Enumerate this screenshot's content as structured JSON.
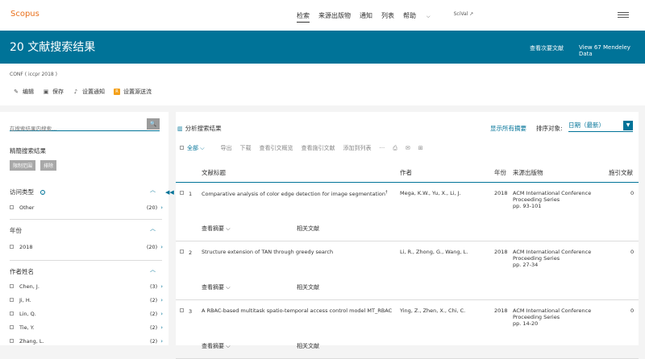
{
  "header": {
    "logo": "Scopus",
    "nav": [
      "检索",
      "来源出版物",
      "通知",
      "列表",
      "帮助"
    ],
    "chevron": "⌵",
    "scival": "SciVal ↗"
  },
  "banner": {
    "title": "20 文献搜索结果",
    "view_secondary": "查看次要文献",
    "view_mendeley": "View 67 Mendeley Data"
  },
  "query": "CONF ( iccpr  2018 )",
  "actions": [
    {
      "label": "编辑",
      "icon": "pencil-icon",
      "glyph": "✎"
    },
    {
      "label": "保存",
      "icon": "save-icon",
      "glyph": "▣"
    },
    {
      "label": "设置通知",
      "icon": "bell-icon",
      "glyph": "♪"
    },
    {
      "label": "设置源送流",
      "icon": "rss-icon",
      "glyph": "R"
    }
  ],
  "sidebar": {
    "search_placeholder": "在搜索结果内搜索...",
    "search_icon": "🔍",
    "refine_title": "精簡搜索结果",
    "limit_label": "限制范围",
    "exclude_label": "排除",
    "facets": [
      {
        "title": "访问类型",
        "info": "i",
        "items": [
          {
            "label": "Other",
            "count": "(20)"
          }
        ]
      },
      {
        "title": "年份",
        "items": [
          {
            "label": "2018",
            "count": "(20)"
          }
        ]
      },
      {
        "title": "作者姓名",
        "items": [
          {
            "label": "Chen, J.",
            "count": "(3)"
          },
          {
            "label": "Ji, H.",
            "count": "(2)"
          },
          {
            "label": "Lin, Q.",
            "count": "(2)"
          },
          {
            "label": "Tie, Y.",
            "count": "(2)"
          },
          {
            "label": "Zhang, L.",
            "count": "(2)"
          }
        ]
      }
    ],
    "toggle": "︿",
    "arrow": "›",
    "collapse": "◀◀"
  },
  "main": {
    "analyze": "分析搜索结果",
    "show_abstracts": "显示所有摘要",
    "sort_label": "排序对象:",
    "sort_value": "日期（最新）",
    "sort_btn": "▼",
    "toolbar": [
      "全部 ⌵",
      "导出",
      "下载",
      "查看引文概览",
      "查看施引文献",
      "添加到列表",
      "···",
      "⎙",
      "✉",
      "⊞"
    ],
    "columns": [
      "文献标题",
      "作者",
      "年份",
      "来源出版物",
      "施引文献"
    ],
    "view_abstract": "查看摘要 ⌵",
    "related": "相关文献",
    "rows": [
      {
        "num": "1",
        "title": "Comparative analysis of color edge detection for image segmentation",
        "sup": "†",
        "authors": "Mega, K.W., Yu, X., Li, J.",
        "year": "2018",
        "source_line1": "ACM International Conference",
        "source_line2": "Proceeding Series",
        "pages": "pp. 93-101",
        "cited": "0"
      },
      {
        "num": "2",
        "title": "Structure extension of TAN through greedy search",
        "sup": "",
        "authors": "Li, R., Zhong, G., Wang, L.",
        "year": "2018",
        "source_line1": "ACM International Conference",
        "source_line2": "Proceeding Series",
        "pages": "pp. 27-34",
        "cited": "0"
      },
      {
        "num": "3",
        "title": "A RBAC-based multitask spatio-temporal access control model MT_RBAC",
        "sup": "",
        "authors": "Ying, Z., Zhen, X., Chi, C.",
        "year": "2018",
        "source_line1": "ACM International Conference",
        "source_line2": "Proceeding Series",
        "pages": "pp. 14-20",
        "cited": "0"
      }
    ]
  }
}
